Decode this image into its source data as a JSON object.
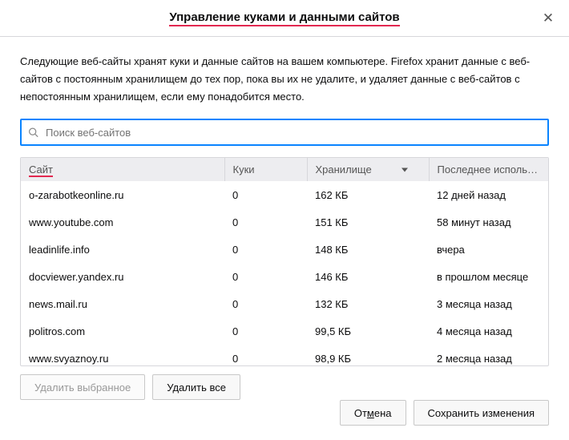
{
  "dialog": {
    "title": "Управление куками и данными сайтов",
    "description": "Следующие веб-сайты хранят куки и данные сайтов на вашем компьютере. Firefox хранит данные с веб-сайтов с постоянным хранилищем до тех пор, пока вы их не удалите, и удаляет данные с веб-сайтов с непостоянным хранилищем, если ему понадобится место."
  },
  "search": {
    "placeholder": "Поиск веб-сайтов"
  },
  "columns": {
    "site": "Сайт",
    "cookies": "Куки",
    "storage": "Хранилище",
    "lastused": "Последнее использ…"
  },
  "rows": [
    {
      "site": "o-zarabotkeonline.ru",
      "cookies": "0",
      "storage": "162 КБ",
      "lastused": "12 дней назад"
    },
    {
      "site": "www.youtube.com",
      "cookies": "0",
      "storage": "151 КБ",
      "lastused": "58 минут назад"
    },
    {
      "site": "leadinlife.info",
      "cookies": "0",
      "storage": "148 КБ",
      "lastused": "вчера"
    },
    {
      "site": "docviewer.yandex.ru",
      "cookies": "0",
      "storage": "146 КБ",
      "lastused": "в прошлом месяце"
    },
    {
      "site": "news.mail.ru",
      "cookies": "0",
      "storage": "132 КБ",
      "lastused": "3 месяца назад"
    },
    {
      "site": "politros.com",
      "cookies": "0",
      "storage": "99,5 КБ",
      "lastused": "4 месяца назад"
    },
    {
      "site": "www.svyaznoy.ru",
      "cookies": "0",
      "storage": "98,9 КБ",
      "lastused": "2 месяца назад"
    }
  ],
  "buttons": {
    "remove_selected": "Удалить выбранное",
    "remove_all": "Удалить все",
    "cancel_prefix": "От",
    "cancel_accel": "м",
    "cancel_suffix": "ена",
    "save": "Сохранить изменения"
  }
}
